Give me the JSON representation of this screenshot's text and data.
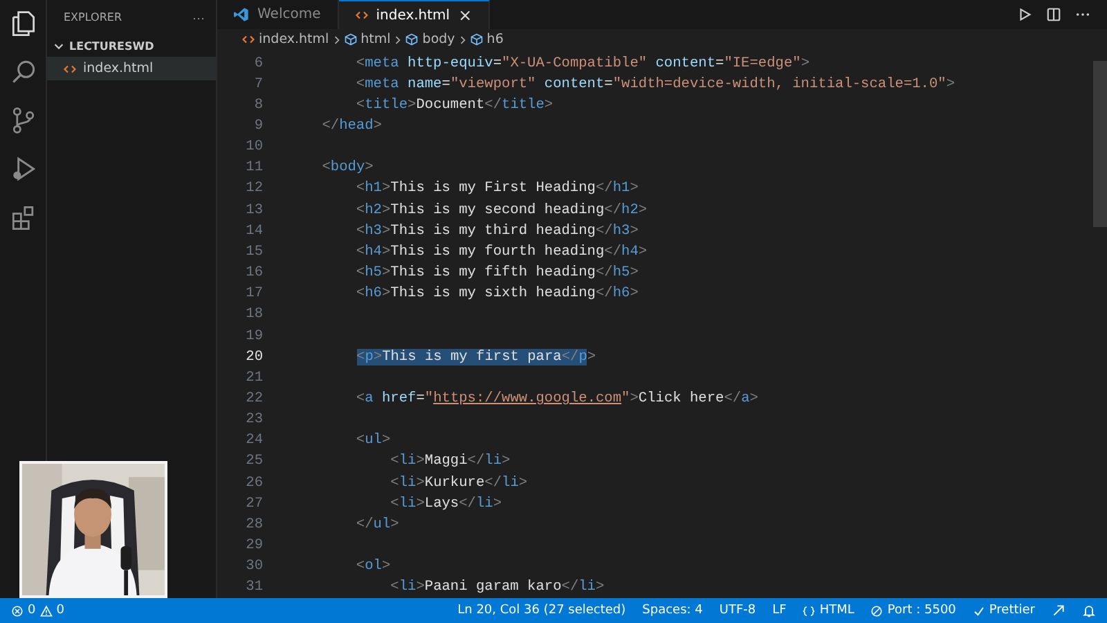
{
  "sidebar": {
    "title": "EXPLORER",
    "more": "···",
    "folder": {
      "name": "LECTURESWD",
      "expanded": true,
      "files": [
        {
          "name": "index.html",
          "selected": true
        }
      ]
    }
  },
  "tabs": [
    {
      "label": "Welcome",
      "kind": "welcome",
      "selected": false
    },
    {
      "label": "index.html",
      "kind": "html",
      "selected": true,
      "close": "×"
    }
  ],
  "breadcrumb": [
    {
      "label": "index.html",
      "kind": "file"
    },
    {
      "label": "html",
      "kind": "element"
    },
    {
      "label": "body",
      "kind": "element"
    },
    {
      "label": "h6",
      "kind": "element"
    }
  ],
  "editor": {
    "lines": [
      {
        "number": "6",
        "current": false,
        "tokens": [
          {
            "kind": "punct",
            "text": "        <"
          },
          {
            "kind": "tag",
            "text": "meta"
          },
          {
            "kind": "attr",
            "text": " http-equiv"
          },
          {
            "kind": "plain",
            "text": "="
          },
          {
            "kind": "string",
            "text": "\"X-UA-Compatible\""
          },
          {
            "kind": "attr",
            "text": " content"
          },
          {
            "kind": "plain",
            "text": "="
          },
          {
            "kind": "string",
            "text": "\"IE=edge\""
          },
          {
            "kind": "punct",
            "text": ">"
          }
        ]
      },
      {
        "number": "7",
        "current": false,
        "tokens": [
          {
            "kind": "punct",
            "text": "        <"
          },
          {
            "kind": "tag",
            "text": "meta"
          },
          {
            "kind": "attr",
            "text": " name"
          },
          {
            "kind": "plain",
            "text": "="
          },
          {
            "kind": "string",
            "text": "\"viewport\""
          },
          {
            "kind": "attr",
            "text": " content"
          },
          {
            "kind": "plain",
            "text": "="
          },
          {
            "kind": "string",
            "text": "\"width=device-width, initial-scale=1.0\""
          },
          {
            "kind": "punct",
            "text": ">"
          }
        ]
      },
      {
        "number": "8",
        "current": false,
        "tokens": [
          {
            "kind": "punct",
            "text": "        <"
          },
          {
            "kind": "tag",
            "text": "title"
          },
          {
            "kind": "punct",
            "text": ">"
          },
          {
            "kind": "plain",
            "text": "Document"
          },
          {
            "kind": "punct",
            "text": "</"
          },
          {
            "kind": "tag",
            "text": "title"
          },
          {
            "kind": "punct",
            "text": ">"
          }
        ]
      },
      {
        "number": "9",
        "current": false,
        "tokens": [
          {
            "kind": "punct",
            "text": "    </"
          },
          {
            "kind": "tag",
            "text": "head"
          },
          {
            "kind": "punct",
            "text": ">"
          }
        ]
      },
      {
        "number": "10",
        "current": false
      },
      {
        "number": "11",
        "current": false,
        "tokens": [
          {
            "kind": "punct",
            "text": "    <"
          },
          {
            "kind": "tag",
            "text": "body"
          },
          {
            "kind": "punct",
            "text": ">"
          }
        ]
      },
      {
        "number": "12",
        "current": false,
        "tokens": [
          {
            "kind": "punct",
            "text": "        <"
          },
          {
            "kind": "tag",
            "text": "h1"
          },
          {
            "kind": "punct",
            "text": ">"
          },
          {
            "kind": "plain",
            "text": "This is my First Heading"
          },
          {
            "kind": "punct",
            "text": "</"
          },
          {
            "kind": "tag",
            "text": "h1"
          },
          {
            "kind": "punct",
            "text": ">"
          }
        ]
      },
      {
        "number": "13",
        "current": false,
        "tokens": [
          {
            "kind": "punct",
            "text": "        <"
          },
          {
            "kind": "tag",
            "text": "h2"
          },
          {
            "kind": "punct",
            "text": ">"
          },
          {
            "kind": "plain",
            "text": "This is my second heading"
          },
          {
            "kind": "punct",
            "text": "</"
          },
          {
            "kind": "tag",
            "text": "h2"
          },
          {
            "kind": "punct",
            "text": ">"
          }
        ]
      },
      {
        "number": "14",
        "current": false,
        "tokens": [
          {
            "kind": "punct",
            "text": "        <"
          },
          {
            "kind": "tag",
            "text": "h3"
          },
          {
            "kind": "punct",
            "text": ">"
          },
          {
            "kind": "plain",
            "text": "This is my third heading"
          },
          {
            "kind": "punct",
            "text": "</"
          },
          {
            "kind": "tag",
            "text": "h3"
          },
          {
            "kind": "punct",
            "text": ">"
          }
        ]
      },
      {
        "number": "15",
        "current": false,
        "tokens": [
          {
            "kind": "punct",
            "text": "        <"
          },
          {
            "kind": "tag",
            "text": "h4"
          },
          {
            "kind": "punct",
            "text": ">"
          },
          {
            "kind": "plain",
            "text": "This is my fourth heading"
          },
          {
            "kind": "punct",
            "text": "</"
          },
          {
            "kind": "tag",
            "text": "h4"
          },
          {
            "kind": "punct",
            "text": ">"
          }
        ]
      },
      {
        "number": "16",
        "current": false,
        "tokens": [
          {
            "kind": "punct",
            "text": "        <"
          },
          {
            "kind": "tag",
            "text": "h5"
          },
          {
            "kind": "punct",
            "text": ">"
          },
          {
            "kind": "plain",
            "text": "This is my fifth heading"
          },
          {
            "kind": "punct",
            "text": "</"
          },
          {
            "kind": "tag",
            "text": "h5"
          },
          {
            "kind": "punct",
            "text": ">"
          }
        ]
      },
      {
        "number": "17",
        "current": false,
        "tokens": [
          {
            "kind": "punct",
            "text": "        <"
          },
          {
            "kind": "tag",
            "text": "h6"
          },
          {
            "kind": "punct",
            "text": ">"
          },
          {
            "kind": "plain",
            "text": "This is my sixth heading"
          },
          {
            "kind": "punct",
            "text": "</"
          },
          {
            "kind": "tag",
            "text": "h6"
          },
          {
            "kind": "punct",
            "text": ">"
          }
        ]
      },
      {
        "number": "18",
        "current": false
      },
      {
        "number": "19",
        "current": false
      },
      {
        "number": "20",
        "current": true,
        "tokens": [
          {
            "kind": "punct",
            "text": "<",
            "selected": true
          },
          {
            "kind": "tag",
            "text": "p",
            "selected": true
          },
          {
            "kind": "punct",
            "text": ">",
            "selected": true
          },
          {
            "kind": "plain",
            "text": "This is my first para",
            "selected": true
          },
          {
            "kind": "punct",
            "text": "</",
            "selected": true
          },
          {
            "kind": "tag",
            "text": "p",
            "selected": true
          },
          {
            "kind": "punct",
            "text": ">",
            "selected": false
          }
        ]
      },
      {
        "number": "21",
        "current": false
      },
      {
        "number": "22",
        "current": false,
        "tokens": [
          {
            "kind": "punct",
            "text": "        <"
          },
          {
            "kind": "tag",
            "text": "a"
          },
          {
            "kind": "attr",
            "text": " href"
          },
          {
            "kind": "plain",
            "text": "="
          },
          {
            "kind": "string",
            "text": "\""
          },
          {
            "kind": "link",
            "text": "https://www.google.com"
          },
          {
            "kind": "string",
            "text": "\""
          },
          {
            "kind": "punct",
            "text": ">"
          },
          {
            "kind": "plain",
            "text": "Click here"
          },
          {
            "kind": "punct",
            "text": "</"
          },
          {
            "kind": "tag",
            "text": "a"
          },
          {
            "kind": "punct",
            "text": ">"
          }
        ]
      },
      {
        "number": "23",
        "current": false
      },
      {
        "number": "24",
        "current": false,
        "tokens": [
          {
            "kind": "punct",
            "text": "        <"
          },
          {
            "kind": "tag",
            "text": "ul"
          },
          {
            "kind": "punct",
            "text": ">"
          }
        ]
      },
      {
        "number": "25",
        "current": false,
        "tokens": [
          {
            "kind": "punct",
            "text": "            <"
          },
          {
            "kind": "tag",
            "text": "li"
          },
          {
            "kind": "punct",
            "text": ">"
          },
          {
            "kind": "plain",
            "text": "Maggi"
          },
          {
            "kind": "punct",
            "text": "</"
          },
          {
            "kind": "tag",
            "text": "li"
          },
          {
            "kind": "punct",
            "text": ">"
          }
        ]
      },
      {
        "number": "26",
        "current": false,
        "tokens": [
          {
            "kind": "punct",
            "text": "            <"
          },
          {
            "kind": "tag",
            "text": "li"
          },
          {
            "kind": "punct",
            "text": ">"
          },
          {
            "kind": "plain",
            "text": "Kurkure"
          },
          {
            "kind": "punct",
            "text": "</"
          },
          {
            "kind": "tag",
            "text": "li"
          },
          {
            "kind": "punct",
            "text": ">"
          }
        ]
      },
      {
        "number": "27",
        "current": false,
        "tokens": [
          {
            "kind": "punct",
            "text": "            <"
          },
          {
            "kind": "tag",
            "text": "li"
          },
          {
            "kind": "punct",
            "text": ">"
          },
          {
            "kind": "plain",
            "text": "Lays"
          },
          {
            "kind": "punct",
            "text": "</"
          },
          {
            "kind": "tag",
            "text": "li"
          },
          {
            "kind": "punct",
            "text": ">"
          }
        ]
      },
      {
        "number": "28",
        "current": false,
        "tokens": [
          {
            "kind": "punct",
            "text": "        </"
          },
          {
            "kind": "tag",
            "text": "ul"
          },
          {
            "kind": "punct",
            "text": ">"
          }
        ]
      },
      {
        "number": "29",
        "current": false
      },
      {
        "number": "30",
        "current": false,
        "tokens": [
          {
            "kind": "punct",
            "text": "        <"
          },
          {
            "kind": "tag",
            "text": "ol"
          },
          {
            "kind": "punct",
            "text": ">"
          }
        ]
      },
      {
        "number": "31",
        "current": false,
        "tokens": [
          {
            "kind": "punct",
            "text": "            <"
          },
          {
            "kind": "tag",
            "text": "li"
          },
          {
            "kind": "punct",
            "text": ">"
          },
          {
            "kind": "plain",
            "text": "Paani garam karo"
          },
          {
            "kind": "punct",
            "text": "</"
          },
          {
            "kind": "tag",
            "text": "li"
          },
          {
            "kind": "punct",
            "text": ">"
          }
        ]
      }
    ]
  },
  "status_bar": {
    "errors": "0",
    "warnings": "0",
    "items": [
      {
        "label": "Ln 20, Col 36 (27 selected)",
        "kind": "text"
      },
      {
        "label": "Spaces: 4",
        "kind": "text"
      },
      {
        "label": "UTF-8",
        "kind": "text"
      },
      {
        "label": "LF",
        "kind": "text"
      },
      {
        "label": "HTML",
        "kind": "language"
      },
      {
        "label": "Port : 5500",
        "kind": "port"
      },
      {
        "label": "Prettier",
        "kind": "check"
      }
    ]
  }
}
